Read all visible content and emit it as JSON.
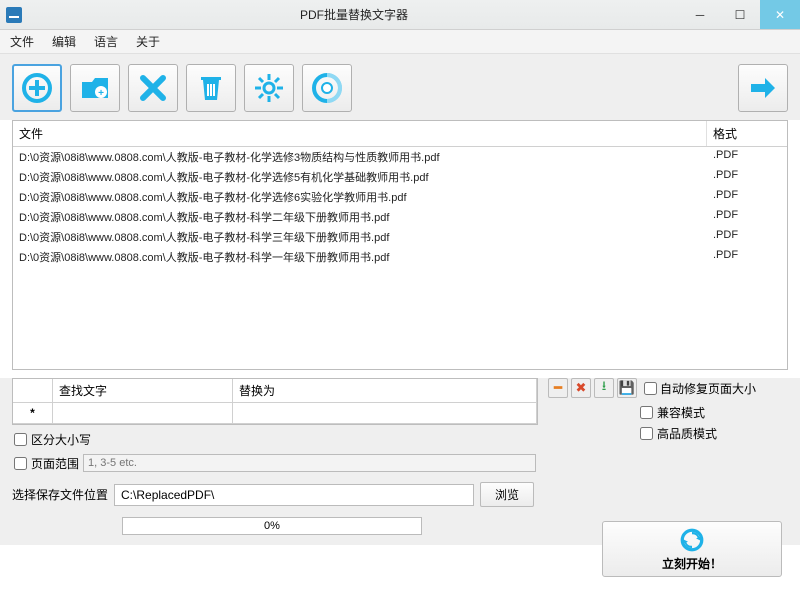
{
  "window": {
    "title": "PDF批量替换文字器"
  },
  "menu": {
    "file": "文件",
    "edit": "编辑",
    "language": "语言",
    "about": "关于"
  },
  "table": {
    "header_file": "文件",
    "header_format": "格式",
    "rows": [
      {
        "path": "D:\\0资源\\08i8\\www.0808.com\\人教版-电子教材-化学选修3物质结构与性质教师用书.pdf",
        "fmt": ".PDF"
      },
      {
        "path": "D:\\0资源\\08i8\\www.0808.com\\人教版-电子教材-化学选修5有机化学基础教师用书.pdf",
        "fmt": ".PDF"
      },
      {
        "path": "D:\\0资源\\08i8\\www.0808.com\\人教版-电子教材-化学选修6实验化学教师用书.pdf",
        "fmt": ".PDF"
      },
      {
        "path": "D:\\0资源\\08i8\\www.0808.com\\人教版-电子教材-科学二年级下册教师用书.pdf",
        "fmt": ".PDF"
      },
      {
        "path": "D:\\0资源\\08i8\\www.0808.com\\人教版-电子教材-科学三年级下册教师用书.pdf",
        "fmt": ".PDF"
      },
      {
        "path": "D:\\0资源\\08i8\\www.0808.com\\人教版-电子教材-科学一年级下册教师用书.pdf",
        "fmt": ".PDF"
      }
    ]
  },
  "replace": {
    "find": "查找文字",
    "repl": "替换为",
    "star": "*"
  },
  "opts": {
    "case_sensitive": "区分大小写",
    "page_range": "页面范围",
    "page_range_placeholder": "1, 3-5 etc.",
    "auto_fix": "自动修复页面大小",
    "compat": "兼容模式",
    "hq": "高品质模式"
  },
  "bottom": {
    "save_label": "选择保存文件位置",
    "save_path": "C:\\ReplacedPDF\\",
    "browse": "浏览",
    "progress": "0%",
    "start": "立刻开始！"
  },
  "colors": {
    "accent": "#1fb2e8"
  }
}
